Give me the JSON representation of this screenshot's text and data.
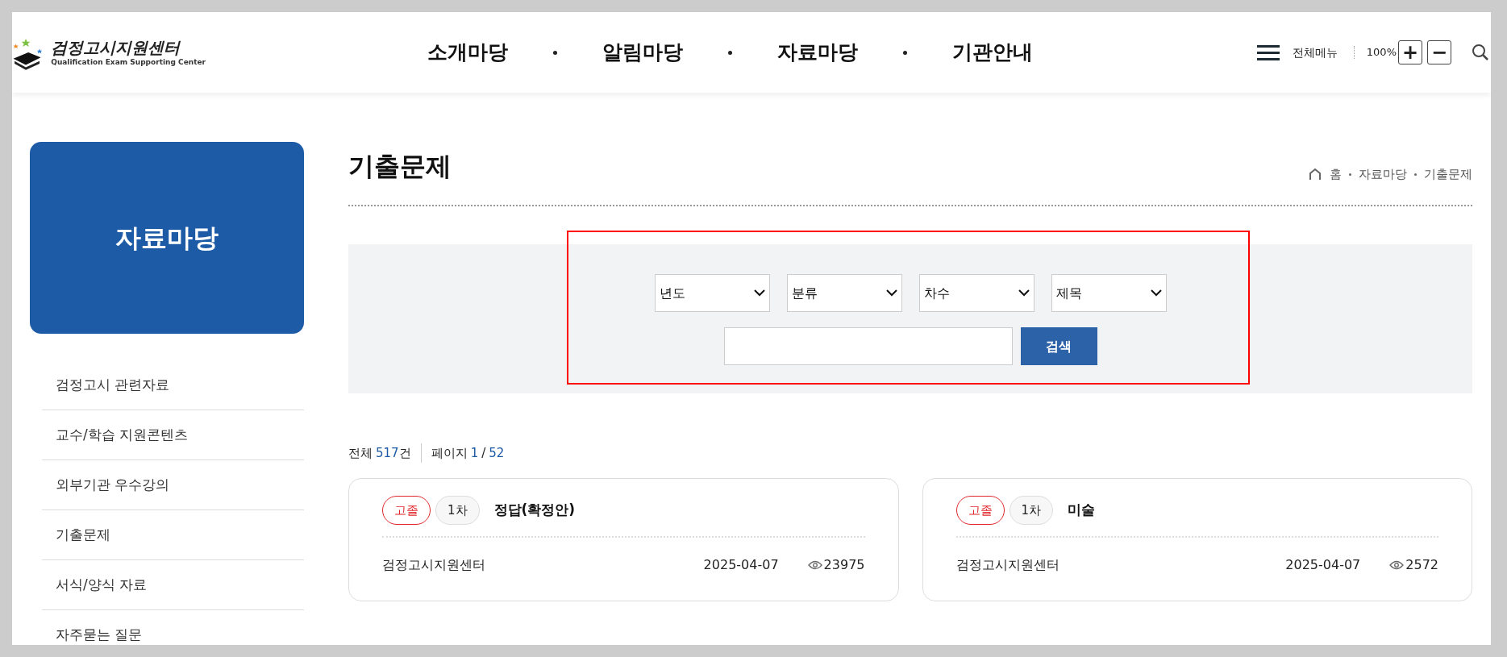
{
  "logo": {
    "title": "검정고시지원센터",
    "subtitle": "Qualification Exam Supporting Center"
  },
  "nav": [
    "소개마당",
    "알림마당",
    "자료마당",
    "기관안내"
  ],
  "utility": {
    "menu_label": "전체메뉴",
    "zoom": "100%",
    "zoom_in": "+",
    "zoom_out": "−"
  },
  "sidebar": {
    "title": "자료마당",
    "items": [
      "검정고시 관련자료",
      "교수/학습 지원콘텐츠",
      "외부기관 우수강의",
      "기출문제",
      "서식/양식 자료",
      "자주묻는 질문"
    ]
  },
  "page_title": "기출문제",
  "breadcrumb": [
    "홈",
    "자료마당",
    "기출문제"
  ],
  "search": {
    "selects": [
      "년도",
      "분류",
      "차수",
      "제목"
    ],
    "button": "검색"
  },
  "summary": {
    "total_label": "전체",
    "total": "517",
    "total_unit": "건",
    "page_label": "페이지",
    "page": "1",
    "separator": "/",
    "pages": "52"
  },
  "posts": [
    {
      "level": "고졸",
      "round": "1차",
      "title": "정답(확정안)",
      "author": "검정고시지원센터",
      "date": "2025-04-07",
      "views": "23975"
    },
    {
      "level": "고졸",
      "round": "1차",
      "title": "미술",
      "author": "검정고시지원센터",
      "date": "2025-04-07",
      "views": "2572"
    }
  ]
}
